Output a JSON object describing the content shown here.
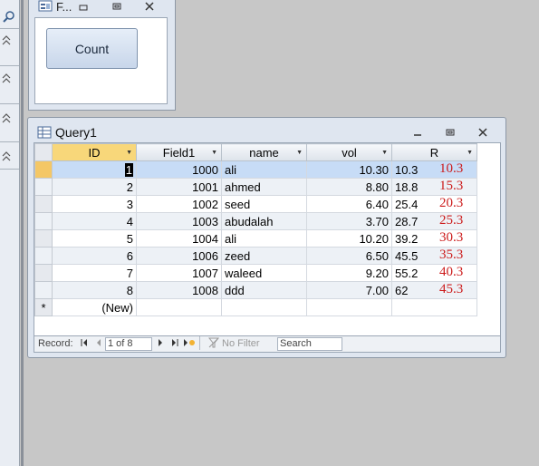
{
  "form_window": {
    "title": "F...",
    "count_button": "Count"
  },
  "query_window": {
    "title": "Query1"
  },
  "columns": [
    "ID",
    "Field1",
    "name",
    "vol",
    "R"
  ],
  "rows": [
    {
      "id": "1",
      "field1": "1000",
      "name": "ali",
      "vol": "10.30",
      "r": "10.3",
      "r2": "10.3"
    },
    {
      "id": "2",
      "field1": "1001",
      "name": "ahmed",
      "vol": "8.80",
      "r": "18.8",
      "r2": "15.3"
    },
    {
      "id": "3",
      "field1": "1002",
      "name": "seed",
      "vol": "6.40",
      "r": "25.4",
      "r2": "20.3"
    },
    {
      "id": "4",
      "field1": "1003",
      "name": "abudalah",
      "vol": "3.70",
      "r": "28.7",
      "r2": "25.3"
    },
    {
      "id": "5",
      "field1": "1004",
      "name": "ali",
      "vol": "10.20",
      "r": "39.2",
      "r2": "30.3"
    },
    {
      "id": "6",
      "field1": "1006",
      "name": "zeed",
      "vol": "6.50",
      "r": "45.5",
      "r2": "35.3"
    },
    {
      "id": "7",
      "field1": "1007",
      "name": "waleed",
      "vol": "9.20",
      "r": "55.2",
      "r2": "40.3"
    },
    {
      "id": "8",
      "field1": "1008",
      "name": "ddd",
      "vol": "7.00",
      "r": "62",
      "r2": "45.3"
    }
  ],
  "new_row": {
    "marker": "*",
    "label": "(New)"
  },
  "record_bar": {
    "label": "Record:",
    "position": "1 of 8",
    "filter": "No Filter",
    "search": "Search"
  },
  "icons": {
    "minimize": "minimize-icon",
    "restore": "restore-icon",
    "close": "close-icon"
  }
}
